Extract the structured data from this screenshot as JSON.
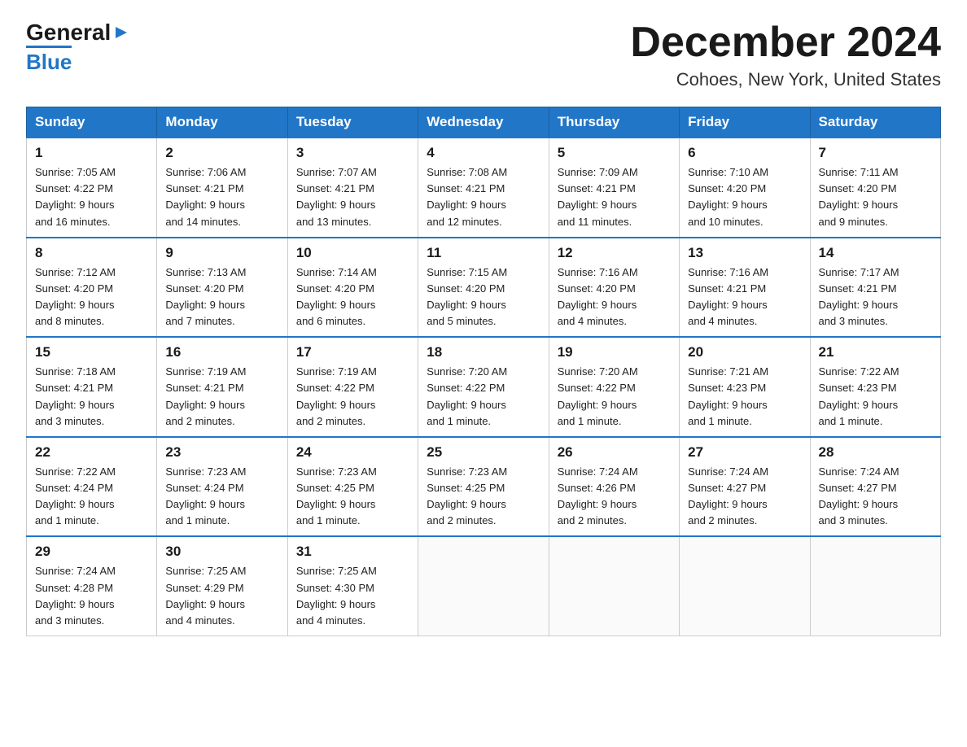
{
  "header": {
    "logo_general": "General",
    "logo_blue": "Blue",
    "month_title": "December 2024",
    "location": "Cohoes, New York, United States"
  },
  "days_of_week": [
    "Sunday",
    "Monday",
    "Tuesday",
    "Wednesday",
    "Thursday",
    "Friday",
    "Saturday"
  ],
  "weeks": [
    [
      {
        "day": "1",
        "sunrise": "7:05 AM",
        "sunset": "4:22 PM",
        "daylight": "9 hours and 16 minutes."
      },
      {
        "day": "2",
        "sunrise": "7:06 AM",
        "sunset": "4:21 PM",
        "daylight": "9 hours and 14 minutes."
      },
      {
        "day": "3",
        "sunrise": "7:07 AM",
        "sunset": "4:21 PM",
        "daylight": "9 hours and 13 minutes."
      },
      {
        "day": "4",
        "sunrise": "7:08 AM",
        "sunset": "4:21 PM",
        "daylight": "9 hours and 12 minutes."
      },
      {
        "day": "5",
        "sunrise": "7:09 AM",
        "sunset": "4:21 PM",
        "daylight": "9 hours and 11 minutes."
      },
      {
        "day": "6",
        "sunrise": "7:10 AM",
        "sunset": "4:20 PM",
        "daylight": "9 hours and 10 minutes."
      },
      {
        "day": "7",
        "sunrise": "7:11 AM",
        "sunset": "4:20 PM",
        "daylight": "9 hours and 9 minutes."
      }
    ],
    [
      {
        "day": "8",
        "sunrise": "7:12 AM",
        "sunset": "4:20 PM",
        "daylight": "9 hours and 8 minutes."
      },
      {
        "day": "9",
        "sunrise": "7:13 AM",
        "sunset": "4:20 PM",
        "daylight": "9 hours and 7 minutes."
      },
      {
        "day": "10",
        "sunrise": "7:14 AM",
        "sunset": "4:20 PM",
        "daylight": "9 hours and 6 minutes."
      },
      {
        "day": "11",
        "sunrise": "7:15 AM",
        "sunset": "4:20 PM",
        "daylight": "9 hours and 5 minutes."
      },
      {
        "day": "12",
        "sunrise": "7:16 AM",
        "sunset": "4:20 PM",
        "daylight": "9 hours and 4 minutes."
      },
      {
        "day": "13",
        "sunrise": "7:16 AM",
        "sunset": "4:21 PM",
        "daylight": "9 hours and 4 minutes."
      },
      {
        "day": "14",
        "sunrise": "7:17 AM",
        "sunset": "4:21 PM",
        "daylight": "9 hours and 3 minutes."
      }
    ],
    [
      {
        "day": "15",
        "sunrise": "7:18 AM",
        "sunset": "4:21 PM",
        "daylight": "9 hours and 3 minutes."
      },
      {
        "day": "16",
        "sunrise": "7:19 AM",
        "sunset": "4:21 PM",
        "daylight": "9 hours and 2 minutes."
      },
      {
        "day": "17",
        "sunrise": "7:19 AM",
        "sunset": "4:22 PM",
        "daylight": "9 hours and 2 minutes."
      },
      {
        "day": "18",
        "sunrise": "7:20 AM",
        "sunset": "4:22 PM",
        "daylight": "9 hours and 1 minute."
      },
      {
        "day": "19",
        "sunrise": "7:20 AM",
        "sunset": "4:22 PM",
        "daylight": "9 hours and 1 minute."
      },
      {
        "day": "20",
        "sunrise": "7:21 AM",
        "sunset": "4:23 PM",
        "daylight": "9 hours and 1 minute."
      },
      {
        "day": "21",
        "sunrise": "7:22 AM",
        "sunset": "4:23 PM",
        "daylight": "9 hours and 1 minute."
      }
    ],
    [
      {
        "day": "22",
        "sunrise": "7:22 AM",
        "sunset": "4:24 PM",
        "daylight": "9 hours and 1 minute."
      },
      {
        "day": "23",
        "sunrise": "7:23 AM",
        "sunset": "4:24 PM",
        "daylight": "9 hours and 1 minute."
      },
      {
        "day": "24",
        "sunrise": "7:23 AM",
        "sunset": "4:25 PM",
        "daylight": "9 hours and 1 minute."
      },
      {
        "day": "25",
        "sunrise": "7:23 AM",
        "sunset": "4:25 PM",
        "daylight": "9 hours and 2 minutes."
      },
      {
        "day": "26",
        "sunrise": "7:24 AM",
        "sunset": "4:26 PM",
        "daylight": "9 hours and 2 minutes."
      },
      {
        "day": "27",
        "sunrise": "7:24 AM",
        "sunset": "4:27 PM",
        "daylight": "9 hours and 2 minutes."
      },
      {
        "day": "28",
        "sunrise": "7:24 AM",
        "sunset": "4:27 PM",
        "daylight": "9 hours and 3 minutes."
      }
    ],
    [
      {
        "day": "29",
        "sunrise": "7:24 AM",
        "sunset": "4:28 PM",
        "daylight": "9 hours and 3 minutes."
      },
      {
        "day": "30",
        "sunrise": "7:25 AM",
        "sunset": "4:29 PM",
        "daylight": "9 hours and 4 minutes."
      },
      {
        "day": "31",
        "sunrise": "7:25 AM",
        "sunset": "4:30 PM",
        "daylight": "9 hours and 4 minutes."
      },
      null,
      null,
      null,
      null
    ]
  ],
  "labels": {
    "sunrise": "Sunrise:",
    "sunset": "Sunset:",
    "daylight": "Daylight:"
  }
}
